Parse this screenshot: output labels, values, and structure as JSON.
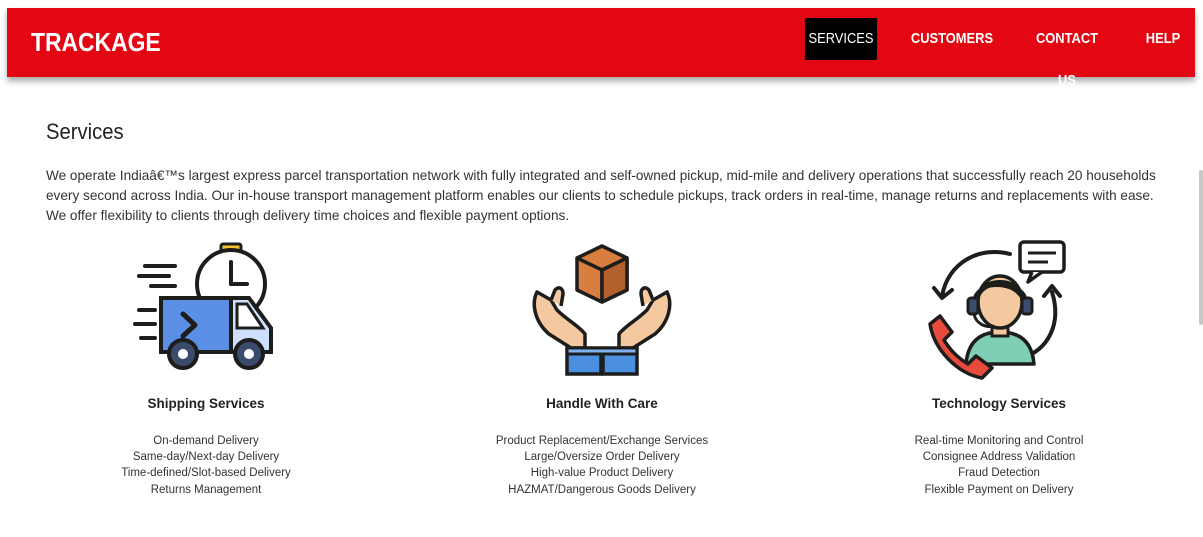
{
  "brand": "TRACKAGE",
  "nav": [
    {
      "label": "SERVICES",
      "active": true
    },
    {
      "label": "CUSTOMERS",
      "active": false
    },
    {
      "label": "CONTACT US",
      "active": false
    },
    {
      "label": "HELP",
      "active": false
    }
  ],
  "page": {
    "title": "Services",
    "intro": "We operate Indiaâ€™s largest express parcel transportation network with fully integrated and self-owned pickup, mid-mile and delivery operations that successfully reach 20 households every second across India. Our in-house transport management platform enables our clients to schedule pickups, track orders in real-time, manage returns and replacements with ease. We offer flexibility to clients through delivery time choices and flexible payment options."
  },
  "services": [
    {
      "icon": "delivery-truck-clock-icon",
      "title": "Shipping Services",
      "items": [
        "On-demand Delivery",
        "Same-day/Next-day Delivery",
        "Time-defined/Slot-based Delivery",
        "Returns Management"
      ]
    },
    {
      "icon": "hands-box-icon",
      "title": "Handle With Care",
      "items": [
        "Product Replacement/Exchange Services",
        "Large/Oversize Order Delivery",
        "High-value Product Delivery",
        "HAZMAT/Dangerous Goods Delivery"
      ]
    },
    {
      "icon": "support-agent-icon",
      "title": "Technology Services",
      "items": [
        "Real-time Monitoring and Control",
        "Consignee Address Validation",
        "Fraud Detection",
        "Flexible Payment on Delivery"
      ]
    }
  ],
  "colors": {
    "brand_red": "#e30613",
    "active_nav_bg": "#000000",
    "truck_blue": "#5b8fe6",
    "box_brown": "#c8703a",
    "skin": "#f5c9a0",
    "agent_green": "#7ecfb6",
    "phone_red": "#e84a3c"
  }
}
